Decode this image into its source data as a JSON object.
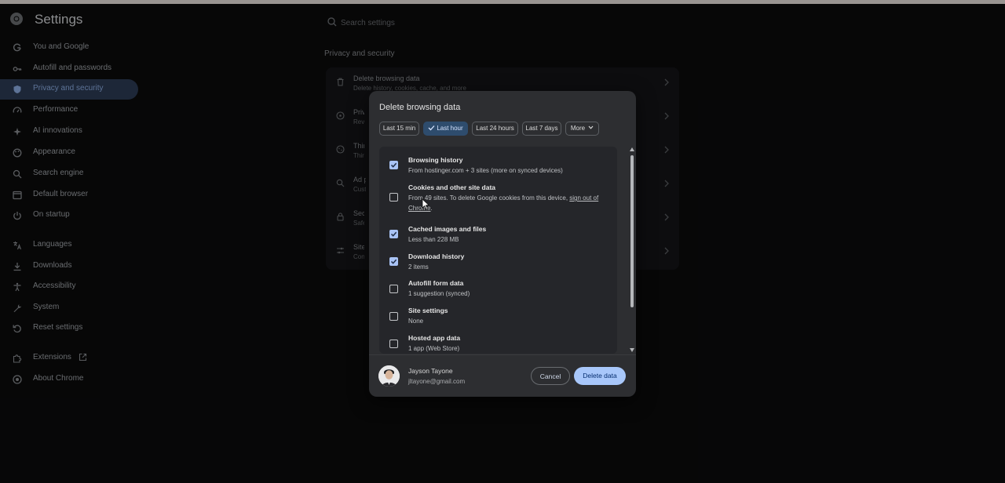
{
  "app": {
    "title": "Settings"
  },
  "search": {
    "placeholder": "Search settings"
  },
  "sidebar": {
    "items": [
      {
        "label": "You and Google",
        "icon": "google-g-icon"
      },
      {
        "label": "Autofill and passwords",
        "icon": "key-icon"
      },
      {
        "label": "Privacy and security",
        "icon": "shield-icon",
        "active": true
      },
      {
        "label": "Performance",
        "icon": "speedometer-icon"
      },
      {
        "label": "AI innovations",
        "icon": "sparkle-icon"
      },
      {
        "label": "Appearance",
        "icon": "palette-icon"
      },
      {
        "label": "Search engine",
        "icon": "search-icon"
      },
      {
        "label": "Default browser",
        "icon": "browser-window-icon"
      },
      {
        "label": "On startup",
        "icon": "power-icon"
      },
      {
        "label": "Languages",
        "icon": "translate-icon"
      },
      {
        "label": "Downloads",
        "icon": "download-icon"
      },
      {
        "label": "Accessibility",
        "icon": "accessibility-icon"
      },
      {
        "label": "System",
        "icon": "wrench-icon"
      },
      {
        "label": "Reset settings",
        "icon": "reset-icon"
      },
      {
        "label": "Extensions",
        "icon": "puzzle-icon"
      },
      {
        "label": "About Chrome",
        "icon": "chrome-icon"
      }
    ]
  },
  "main": {
    "section_title": "Privacy and security",
    "rows": [
      {
        "title": "Delete browsing data",
        "subtitle": "Delete history, cookies, cache, and more"
      },
      {
        "title": "Priva",
        "subtitle": "Revie"
      },
      {
        "title": "Third",
        "subtitle": "Third"
      },
      {
        "title": "Ad p",
        "subtitle": "Custo"
      },
      {
        "title": "Secu",
        "subtitle": "Safe"
      },
      {
        "title": "Site",
        "subtitle": "Contr"
      }
    ]
  },
  "dialog": {
    "title": "Delete browsing data",
    "time_ranges": [
      {
        "label": "Last 15 min",
        "selected": false
      },
      {
        "label": "Last hour",
        "selected": true
      },
      {
        "label": "Last 24 hours",
        "selected": false
      },
      {
        "label": "Last 7 days",
        "selected": false
      },
      {
        "label": "More",
        "selected": false,
        "dropdown": true
      }
    ],
    "items": [
      {
        "title": "Browsing history",
        "subtitle": "From hostinger.com + 3 sites (more on synced devices)",
        "checked": true
      },
      {
        "title": "Cookies and other site data",
        "subtitle": "From 49 sites. To delete Google cookies from this device, ",
        "link": "sign out of Chrome",
        "suffix": ".",
        "checked": false
      },
      {
        "title": "Cached images and files",
        "subtitle": "Less than 228 MB",
        "checked": true
      },
      {
        "title": "Download history",
        "subtitle": "2 items",
        "checked": true
      },
      {
        "title": "Autofill form data",
        "subtitle": "1 suggestion (synced)",
        "checked": false
      },
      {
        "title": "Site settings",
        "subtitle": "None",
        "checked": false
      },
      {
        "title": "Hosted app data",
        "subtitle": "1 app (Web Store)",
        "checked": false
      }
    ],
    "account": {
      "name": "Jayson Tayone",
      "email": "jltayone@gmail.com"
    },
    "cancel_label": "Cancel",
    "delete_label": "Delete data"
  },
  "colors": {
    "accent": "#a8c7fa",
    "dialog_bg": "#2d2e31",
    "active_nav_bg": "#2d3d56",
    "page_bg": "#0b0b0c"
  }
}
